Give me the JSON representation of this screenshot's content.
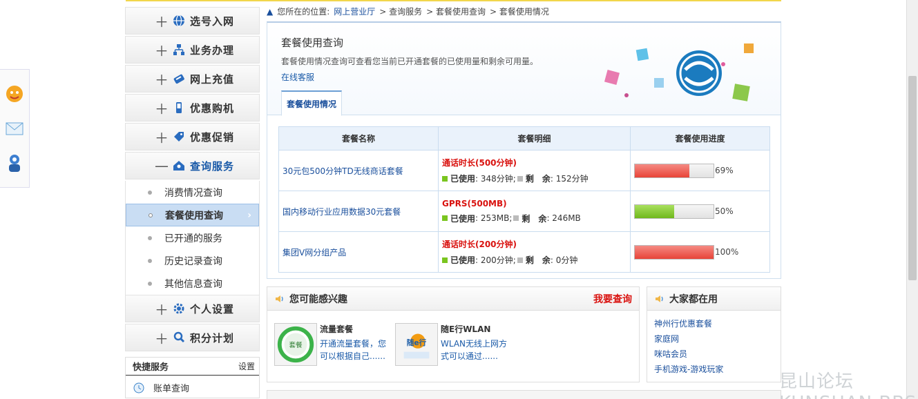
{
  "breadcrumb": {
    "prefix": "您所在的位置:",
    "items": [
      "网上营业厅",
      "> 查询服务",
      "> 套餐使用查询",
      "> 套餐使用情况"
    ]
  },
  "sidebar": {
    "menu": [
      {
        "label": "选号入网",
        "icon": "globe-icon"
      },
      {
        "label": "业务办理",
        "icon": "org-chart-icon"
      },
      {
        "label": "网上充值",
        "icon": "card-icon"
      },
      {
        "label": "优惠购机",
        "icon": "phone-icon"
      },
      {
        "label": "优惠促销",
        "icon": "tag-icon"
      },
      {
        "label": "查询服务",
        "icon": "home-people-icon"
      }
    ],
    "submenu": [
      "消费情况查询",
      "套餐使用查询",
      "已开通的服务",
      "历史记录查询",
      "其他信息查询"
    ],
    "menu2": [
      {
        "label": "个人设置",
        "icon": "gear-icon"
      },
      {
        "label": "积分计划",
        "icon": "person-search-icon"
      }
    ],
    "quick": {
      "title": "快捷服务",
      "settings": "设置",
      "first": "账单查询"
    }
  },
  "main": {
    "title": "套餐使用查询",
    "description": "套餐使用情况查询可查看您当前已开通套餐的已使用量和剩余可用量。",
    "service_link": "在线客服",
    "tab": "套餐使用情况",
    "table": {
      "headers": [
        "套餐名称",
        "套餐明细",
        "套餐使用进度"
      ],
      "rows": [
        {
          "name": "30元包500分钟TD无线商话套餐",
          "detail_title": "通话时长(500分钟)",
          "used_label": "已使用",
          "used": "348分钟",
          "remain_label": "剩　余",
          "remain": "152分钟",
          "percent": 0.69,
          "percent_text": "69%",
          "bar_color": "#e84438"
        },
        {
          "name": "国内移动行业应用数据30元套餐",
          "detail_title": "GPRS(500MB)",
          "used_label": "已使用",
          "used": "253MB",
          "remain_label": "剩　余",
          "remain": "246MB",
          "percent": 0.5,
          "percent_text": "50%",
          "bar_color": "#6fb81c"
        },
        {
          "name": "集团V网分组产品",
          "detail_title": "通话时长(200分钟)",
          "used_label": "已使用",
          "used": "200分钟",
          "remain_label": "剩　余",
          "remain": "0分钟",
          "percent": 1.0,
          "percent_text": "100%",
          "bar_color": "#e84438"
        }
      ]
    }
  },
  "interest": {
    "title": "您可能感兴趣",
    "action": "我要查询",
    "cards": [
      {
        "title": "流量套餐",
        "text": "开通流量套餐，您可以根据自己......",
        "icon": "package-icon",
        "icon_text": "套餐"
      },
      {
        "title": "随E行WLAN",
        "text": "WLAN无线上网方式可以通过......",
        "icon": "wlan-icon",
        "icon_text": "随e行"
      }
    ]
  },
  "popular": {
    "title": "大家都在用",
    "items": [
      "神州行优惠套餐",
      "家庭网",
      "咪咕会员",
      "手机游戏-游戏玩家"
    ]
  },
  "watermark": "昆山论坛 KUNSHAN BBS"
}
